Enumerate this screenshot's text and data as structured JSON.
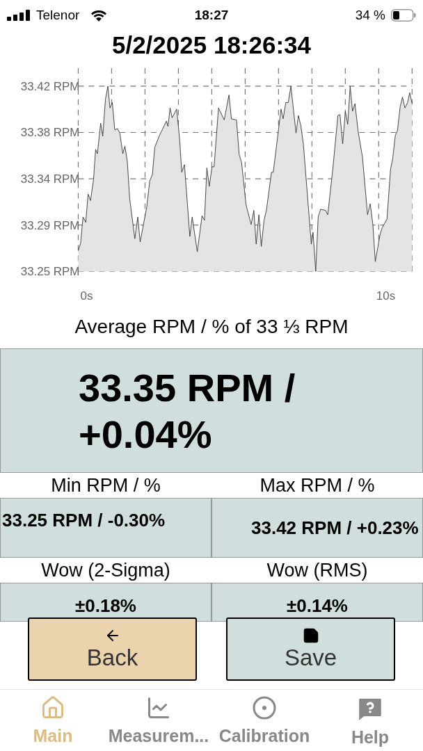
{
  "status_bar": {
    "carrier": "Telenor",
    "time": "18:27",
    "battery": "34 %"
  },
  "title": "5/2/2025 18:26:34",
  "chart": {
    "chart_data": {
      "type": "area",
      "x": [
        -0.28,
        -0.2,
        -0.12,
        -0.03,
        0.05,
        0.13,
        0.23,
        0.3,
        0.36,
        0.47,
        0.54,
        0.63,
        0.71,
        0.78,
        0.86,
        0.94,
        1.03,
        1.11,
        1.21,
        1.28,
        1.36,
        1.44,
        1.61,
        1.71,
        1.79,
        2.01,
        2.11,
        2.2,
        2.28,
        2.44,
        2.6,
        2.67,
        2.72,
        2.79,
        2.86,
        3.01,
        3.11,
        3.18,
        3.27,
        3.45,
        3.53,
        3.7,
        3.86,
        3.94,
        4.02,
        4.1,
        4.19,
        4.26,
        4.41,
        4.6,
        4.76,
        4.84,
        5.01,
        5.1,
        5.18,
        5.33,
        5.5,
        5.59,
        5.67,
        5.76,
        5.84,
        5.93,
        6.01,
        6.18,
        6.24,
        6.5,
        6.57,
        6.66,
        6.74,
        6.83,
        7,
        7.08,
        7.16,
        7.25,
        7.51,
        7.57,
        7.66,
        7.74,
        7.82,
        7.99,
        8.06,
        8.23,
        8.4,
        8.47,
        8.56,
        8.65,
        8.73,
        8.81,
        8.89,
        8.97,
        9.08,
        9.22,
        9.39,
        9.48,
        9.57,
        9.65,
        9.81,
        9.88,
        10.04,
        10.16,
        10.23,
        10.32,
        10.39,
        10.48,
        10.56,
        10.64,
        10.73,
        10.8,
        10.88
      ],
      "series": [
        {
          "color": "#333333",
          "values": [
            33.269,
            33.276,
            33.3,
            33.295,
            33.321,
            33.315,
            33.334,
            33.362,
            33.358,
            33.386,
            33.374,
            33.408,
            33.42,
            33.4,
            33.405,
            33.38,
            33.381,
            33.377,
            33.358,
            33.365,
            33.351,
            33.317,
            33.28,
            33.3,
            33.277,
            33.309,
            33.333,
            33.339,
            33.364,
            33.375,
            33.384,
            33.388,
            33.383,
            33.4,
            33.391,
            33.399,
            33.371,
            33.341,
            33.348,
            33.282,
            33.3,
            33.268,
            33.301,
            33.297,
            33.345,
            33.328,
            33.346,
            33.346,
            33.4,
            33.389,
            33.412,
            33.39,
            33.389,
            33.357,
            33.35,
            33.311,
            33.293,
            33.306,
            33.275,
            33.302,
            33.273,
            33.297,
            33.306,
            33.341,
            33.341,
            33.399,
            33.39,
            33.405,
            33.405,
            33.42,
            33.377,
            33.393,
            33.384,
            33.366,
            33.275,
            33.286,
            33.25,
            33.3,
            33.307,
            33.306,
            33.302,
            33.344,
            33.393,
            33.394,
            33.367,
            33.397,
            33.385,
            33.42,
            33.397,
            33.404,
            33.378,
            33.355,
            33.302,
            33.312,
            33.293,
            33.259,
            33.284,
            33.29,
            33.298,
            33.344,
            33.353,
            33.375,
            33.379,
            33.401,
            33.41,
            33.4,
            33.405,
            33.414,
            33.404
          ]
        }
      ],
      "xlim": [
        -0.28,
        10.88
      ],
      "ylim": [
        33.25,
        33.42
      ],
      "grid": true,
      "xticks": [
        {
          "value": 0,
          "label": "0s"
        },
        {
          "value": 10,
          "label": "10s"
        }
      ],
      "yticks": [
        {
          "value": 33.42,
          "label": "33.42 RPM"
        },
        {
          "value": 33.3775,
          "label": "33.38 RPM"
        },
        {
          "value": 33.335,
          "label": "33.34 RPM"
        },
        {
          "value": 33.2925,
          "label": "33.29 RPM"
        },
        {
          "value": 33.25,
          "label": "33.25 RPM"
        }
      ]
    }
  },
  "average": {
    "label": "Average RPM / % of 33 ⅓ RPM",
    "value": "33.35 RPM / +0.04%"
  },
  "stats": [
    {
      "label": "Min RPM / %",
      "value": "33.25 RPM / -0.30%"
    },
    {
      "label": "Max RPM / %",
      "value": "33.42 RPM / +0.23%"
    },
    {
      "label": "Wow (2-Sigma)",
      "value": "±0.18%"
    },
    {
      "label": "Wow (RMS)",
      "value": "±0.14%"
    }
  ],
  "buttons": [
    {
      "label": "Back"
    },
    {
      "label": "Save"
    }
  ],
  "tabs": [
    {
      "label": "Main",
      "selected": true
    },
    {
      "label": "Measurem...",
      "selected": false
    },
    {
      "label": "Calibration",
      "selected": false
    },
    {
      "label": "Help",
      "selected": false
    }
  ]
}
